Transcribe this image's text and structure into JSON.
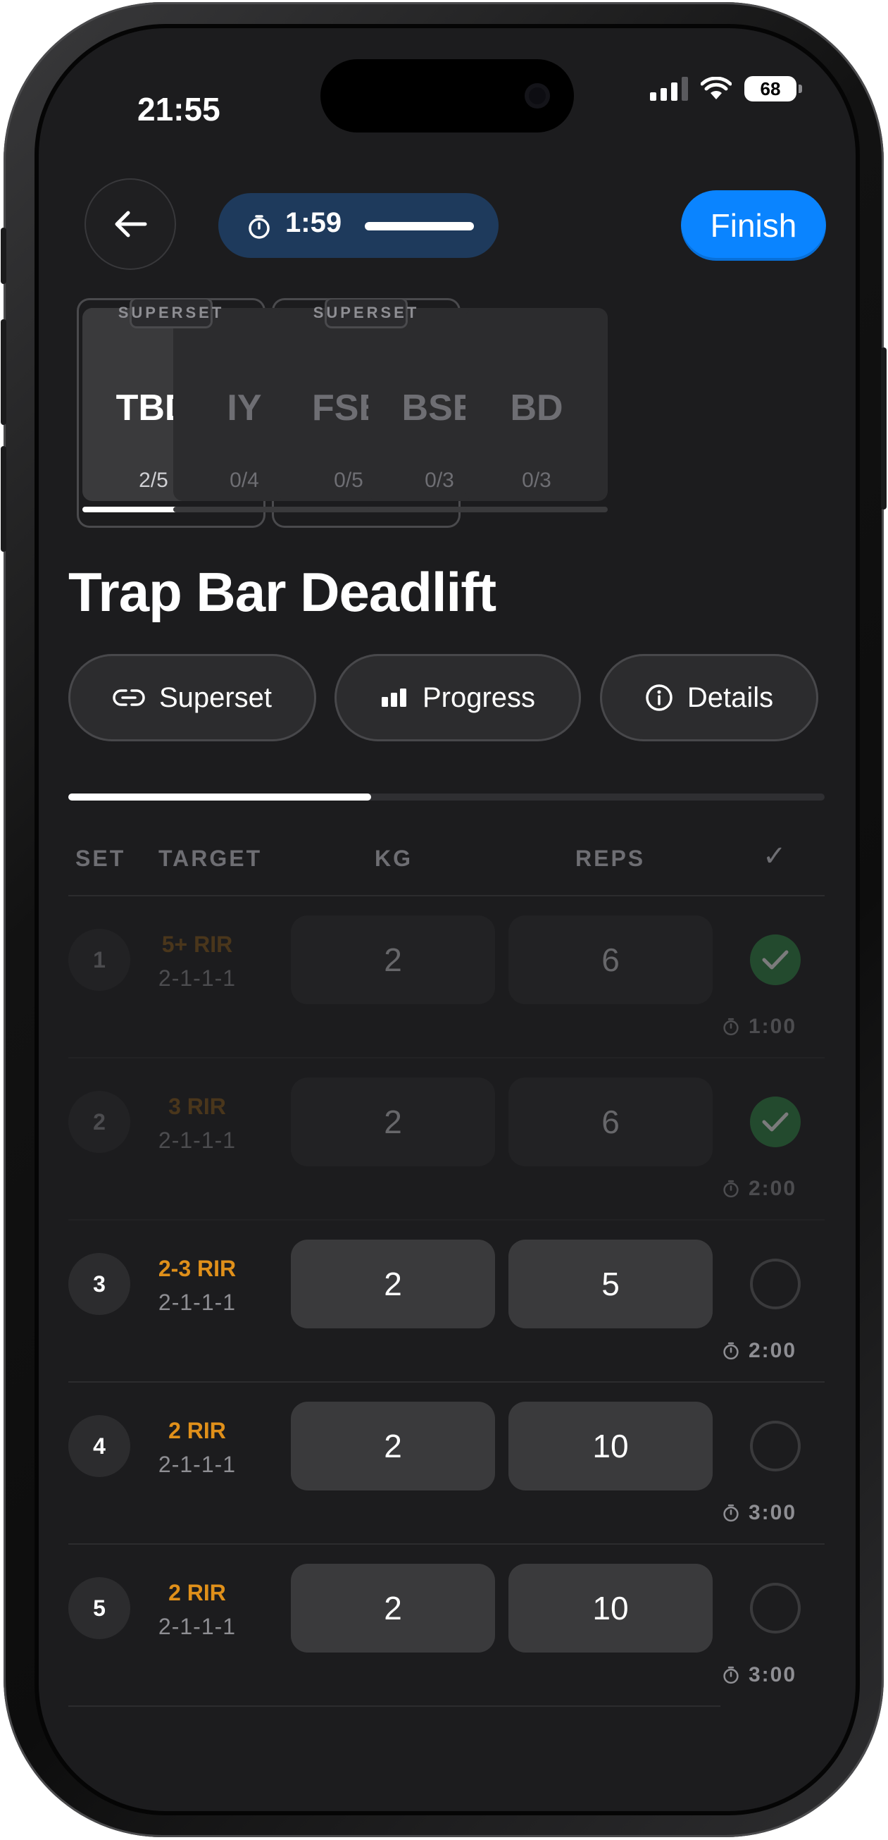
{
  "status": {
    "time": "21:55",
    "battery": "68"
  },
  "header": {
    "timer": "1:59",
    "finish_label": "Finish"
  },
  "exercises": {
    "group_label": "SUPERSET",
    "tiles": [
      {
        "abbr": "TBD",
        "count": "2/5",
        "active": true
      },
      {
        "abbr": "IY",
        "count": "0/4"
      },
      {
        "abbr": "FSB",
        "count": "0/5"
      },
      {
        "abbr": "BSE",
        "count": "0/3"
      },
      {
        "abbr": "BD",
        "count": "0/3"
      }
    ]
  },
  "exercise": {
    "title": "Trap Bar Deadlift"
  },
  "actions": {
    "superset": "Superset",
    "progress": "Progress",
    "details": "Details"
  },
  "set_progress": 0.4,
  "table": {
    "headers": {
      "set": "SET",
      "target": "TARGET",
      "kg": "KG",
      "reps": "REPS",
      "check": "✓"
    },
    "rows": [
      {
        "set": "1",
        "rir": "5+ RIR",
        "scheme": "2-1-1-1",
        "kg": "2",
        "reps": "6",
        "done": true,
        "rest": "1:00"
      },
      {
        "set": "2",
        "rir": "3 RIR",
        "scheme": "2-1-1-1",
        "kg": "2",
        "reps": "6",
        "done": true,
        "rest": "2:00"
      },
      {
        "set": "3",
        "rir": "2-3 RIR",
        "scheme": "2-1-1-1",
        "kg": "2",
        "reps": "5",
        "done": false,
        "rest": "2:00"
      },
      {
        "set": "4",
        "rir": "2 RIR",
        "scheme": "2-1-1-1",
        "kg": "2",
        "reps": "10",
        "done": false,
        "rest": "3:00"
      },
      {
        "set": "5",
        "rir": "2 RIR",
        "scheme": "2-1-1-1",
        "kg": "2",
        "reps": "10",
        "done": false,
        "rest": "3:00"
      }
    ]
  },
  "colors": {
    "accent": "#0a84ff",
    "timer_bg": "#1e3a5c",
    "rir": "#e0901a",
    "check_done": "#2e8a44"
  }
}
